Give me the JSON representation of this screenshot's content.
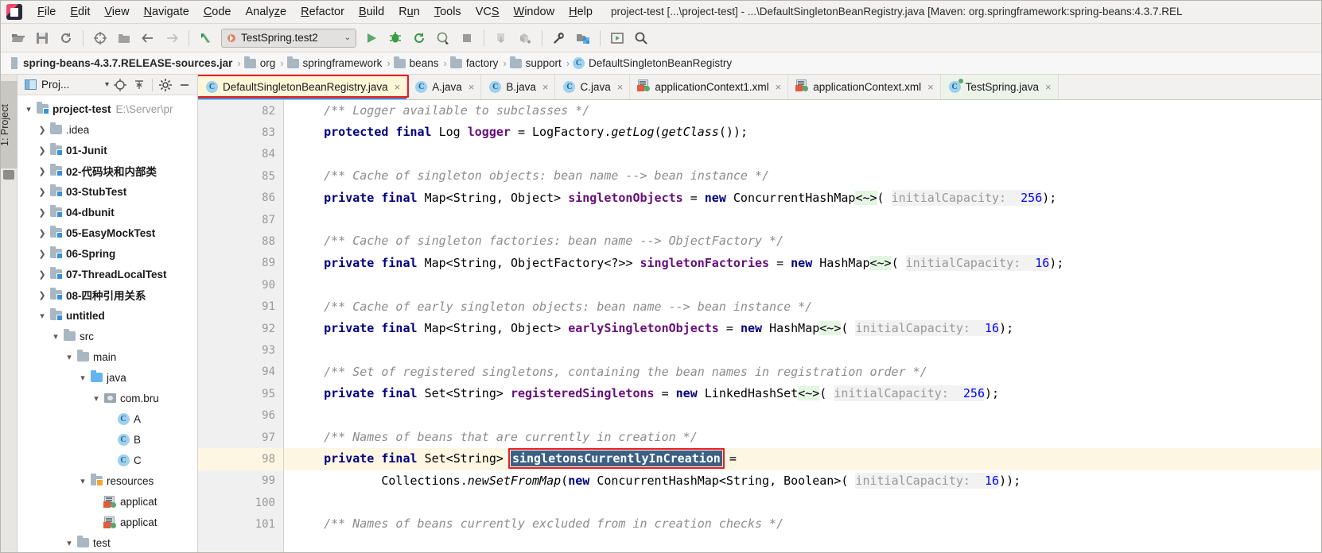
{
  "window": {
    "title": "project-test [...\\project-test] - ...\\DefaultSingletonBeanRegistry.java [Maven: org.springframework:spring-beans:4.3.7.REL",
    "logo_name": "intellij-idea-logo"
  },
  "menubar": {
    "items": [
      {
        "label": "File",
        "mnemonic": "F"
      },
      {
        "label": "Edit",
        "mnemonic": "E"
      },
      {
        "label": "View",
        "mnemonic": "V"
      },
      {
        "label": "Navigate",
        "mnemonic": "N"
      },
      {
        "label": "Code",
        "mnemonic": "C"
      },
      {
        "label": "Analyze",
        "mnemonic": "z"
      },
      {
        "label": "Refactor",
        "mnemonic": "R"
      },
      {
        "label": "Build",
        "mnemonic": "B"
      },
      {
        "label": "Run",
        "mnemonic": "u"
      },
      {
        "label": "Tools",
        "mnemonic": "T"
      },
      {
        "label": "VCS",
        "mnemonic": "S"
      },
      {
        "label": "Window",
        "mnemonic": "W"
      },
      {
        "label": "Help",
        "mnemonic": "H"
      }
    ]
  },
  "toolbar": {
    "buttons": [
      {
        "name": "open-folder-icon",
        "title": "Open"
      },
      {
        "name": "save-all-icon",
        "title": "Save All"
      },
      {
        "name": "sync-refresh-icon",
        "title": "Synchronize"
      },
      {
        "name": "target-crosshair-icon",
        "title": "Select Opened File"
      },
      {
        "name": "folder-icon",
        "title": "Project Structure"
      },
      {
        "name": "back-arrow-icon",
        "title": "Back"
      },
      {
        "name": "forward-arrow-icon",
        "title": "Forward"
      },
      {
        "name": "green-arrow-up-icon",
        "title": "Last Edit Location"
      },
      {
        "name": "run-icon",
        "title": "Run"
      },
      {
        "name": "debug-icon",
        "title": "Debug"
      },
      {
        "name": "run-with-coverage-icon",
        "title": "Run with Coverage"
      },
      {
        "name": "profile-icon",
        "title": "Profile"
      },
      {
        "name": "stop-icon",
        "title": "Stop"
      },
      {
        "name": "update-project-icon",
        "title": "Update Project"
      },
      {
        "name": "commit-icon",
        "title": "Commit"
      },
      {
        "name": "wrench-settings-icon",
        "title": "Settings"
      },
      {
        "name": "project-structure-icon",
        "title": "Project Structure"
      },
      {
        "name": "preview-icon",
        "title": "Preview"
      },
      {
        "name": "search-icon",
        "title": "Search Everywhere"
      }
    ],
    "run_config": {
      "label": "TestSpring.test2",
      "caret": "⌄"
    }
  },
  "breadcrumb": {
    "separator": "›",
    "items": [
      {
        "label": "spring-beans-4.3.7.RELEASE-sources.jar",
        "icon": "jar-icon",
        "bold": true
      },
      {
        "label": "org",
        "icon": "folder-icon"
      },
      {
        "label": "springframework",
        "icon": "folder-icon"
      },
      {
        "label": "beans",
        "icon": "folder-icon"
      },
      {
        "label": "factory",
        "icon": "folder-icon"
      },
      {
        "label": "support",
        "icon": "folder-icon"
      },
      {
        "label": "DefaultSingletonBeanRegistry",
        "icon": "class-icon"
      }
    ]
  },
  "left_strip": {
    "tool_window_label": "1: Project",
    "folder_icon": "folder-icon"
  },
  "project_panel": {
    "title": "Proj...",
    "header_buttons": [
      {
        "name": "project-view-dropdown",
        "label": "Proj..."
      },
      {
        "name": "locate-file-icon"
      },
      {
        "name": "collapse-all-icon"
      },
      {
        "name": "gear-icon"
      },
      {
        "name": "minimize-icon"
      }
    ],
    "tree": [
      {
        "depth": 0,
        "arrow": "down",
        "icon": "module-folder-icon",
        "label": "project-test",
        "bold": true,
        "sub": "E:\\Server\\pr"
      },
      {
        "depth": 1,
        "arrow": "right",
        "icon": "folder-icon",
        "label": ".idea",
        "bold": false
      },
      {
        "depth": 1,
        "arrow": "right",
        "icon": "module-folder-icon",
        "label": "01-Junit",
        "bold": true
      },
      {
        "depth": 1,
        "arrow": "right",
        "icon": "module-folder-icon",
        "label": "02-代码块和内部类",
        "bold": true
      },
      {
        "depth": 1,
        "arrow": "right",
        "icon": "module-folder-icon",
        "label": "03-StubTest",
        "bold": true
      },
      {
        "depth": 1,
        "arrow": "right",
        "icon": "module-folder-icon",
        "label": "04-dbunit",
        "bold": true
      },
      {
        "depth": 1,
        "arrow": "right",
        "icon": "module-folder-icon",
        "label": "05-EasyMockTest",
        "bold": true
      },
      {
        "depth": 1,
        "arrow": "right",
        "icon": "module-folder-icon",
        "label": "06-Spring",
        "bold": true
      },
      {
        "depth": 1,
        "arrow": "right",
        "icon": "module-folder-icon",
        "label": "07-ThreadLocalTest",
        "bold": true
      },
      {
        "depth": 1,
        "arrow": "right",
        "icon": "module-folder-icon",
        "label": "08-四种引用关系",
        "bold": true
      },
      {
        "depth": 1,
        "arrow": "down",
        "icon": "module-folder-icon",
        "label": "untitled",
        "bold": true
      },
      {
        "depth": 2,
        "arrow": "down",
        "icon": "folder-icon",
        "label": "src",
        "bold": false
      },
      {
        "depth": 3,
        "arrow": "down",
        "icon": "folder-icon",
        "label": "main",
        "bold": false
      },
      {
        "depth": 4,
        "arrow": "down",
        "icon": "source-folder-icon",
        "label": "java",
        "bold": false
      },
      {
        "depth": 5,
        "arrow": "down",
        "icon": "package-icon",
        "label": "com.bru",
        "bold": false
      },
      {
        "depth": 6,
        "arrow": "none",
        "icon": "class-icon",
        "label": "A",
        "bold": false
      },
      {
        "depth": 6,
        "arrow": "none",
        "icon": "class-icon",
        "label": "B",
        "bold": false
      },
      {
        "depth": 6,
        "arrow": "none",
        "icon": "class-icon",
        "label": "C",
        "bold": false
      },
      {
        "depth": 4,
        "arrow": "down",
        "icon": "resources-folder-icon",
        "label": "resources",
        "bold": false
      },
      {
        "depth": 5,
        "arrow": "none",
        "icon": "xml-file-icon",
        "label": "applicat",
        "bold": false
      },
      {
        "depth": 5,
        "arrow": "none",
        "icon": "xml-file-icon",
        "label": "applicat",
        "bold": false
      },
      {
        "depth": 3,
        "arrow": "down",
        "icon": "folder-icon",
        "label": "test",
        "bold": false
      }
    ]
  },
  "editor_tabs": {
    "close_glyph": "×",
    "items": [
      {
        "label": "DefaultSingletonBeanRegistry.java",
        "icon": "java-class-icon",
        "state": "active",
        "highlighted": true
      },
      {
        "label": "A.java",
        "icon": "java-class-icon",
        "state": "normal",
        "highlighted": false
      },
      {
        "label": "B.java",
        "icon": "java-class-icon",
        "state": "normal",
        "highlighted": false
      },
      {
        "label": "C.java",
        "icon": "java-class-icon",
        "state": "normal",
        "highlighted": false
      },
      {
        "label": "applicationContext1.xml",
        "icon": "xml-file-icon",
        "state": "normal",
        "highlighted": false
      },
      {
        "label": "applicationContext.xml",
        "icon": "xml-file-icon",
        "state": "normal",
        "highlighted": false
      },
      {
        "label": "TestSpring.java",
        "icon": "java-test-class-icon",
        "state": "selected-green",
        "highlighted": false
      }
    ]
  },
  "editor": {
    "highlighted_line": 98,
    "selected_token": "singletonsCurrentlyInCreation",
    "annotation_color": "#ec1c24",
    "lines": [
      {
        "n": 82,
        "text": "    /** Logger available to subclasses */"
      },
      {
        "n": 83,
        "text": "    protected final Log logger = LogFactory.getLog(getClass());"
      },
      {
        "n": 84,
        "text": ""
      },
      {
        "n": 85,
        "text": "    /** Cache of singleton objects: bean name --> bean instance */"
      },
      {
        "n": 86,
        "text": "    private final Map<String, Object> singletonObjects = new ConcurrentHashMap<~>( initialCapacity: 256);"
      },
      {
        "n": 87,
        "text": ""
      },
      {
        "n": 88,
        "text": "    /** Cache of singleton factories: bean name --> ObjectFactory */"
      },
      {
        "n": 89,
        "text": "    private final Map<String, ObjectFactory<?>> singletonFactories = new HashMap<~>( initialCapacity: 16);"
      },
      {
        "n": 90,
        "text": ""
      },
      {
        "n": 91,
        "text": "    /** Cache of early singleton objects: bean name --> bean instance */"
      },
      {
        "n": 92,
        "text": "    private final Map<String, Object> earlySingletonObjects = new HashMap<~>( initialCapacity: 16);"
      },
      {
        "n": 93,
        "text": ""
      },
      {
        "n": 94,
        "text": "    /** Set of registered singletons, containing the bean names in registration order */"
      },
      {
        "n": 95,
        "text": "    private final Set<String> registeredSingletons = new LinkedHashSet<~>( initialCapacity: 256);"
      },
      {
        "n": 96,
        "text": ""
      },
      {
        "n": 97,
        "text": "    /** Names of beans that are currently in creation */"
      },
      {
        "n": 98,
        "text": "    private final Set<String> singletonsCurrentlyInCreation ="
      },
      {
        "n": 99,
        "text": "            Collections.newSetFromMap(new ConcurrentHashMap<String, Boolean>( initialCapacity: 16));"
      },
      {
        "n": 100,
        "text": ""
      },
      {
        "n": 101,
        "text": "    /** Names of beans currently excluded from in creation checks */"
      }
    ],
    "hints": {
      "initial_capacity_label": "initialCapacity:",
      "values": [
        "256",
        "16",
        "16",
        "256",
        "16"
      ]
    }
  },
  "colors": {
    "accent_blue": "#3c8ad6",
    "annotation_red": "#ec1c24",
    "keyword_navy": "#000080",
    "field_purple": "#660e7a",
    "comment_gray": "#8c8c8c",
    "number_blue": "#0000ff",
    "highlight_line": "#fdf6e3",
    "active_tab": "#fdf6d8",
    "selection_blue": "#3d6185"
  }
}
